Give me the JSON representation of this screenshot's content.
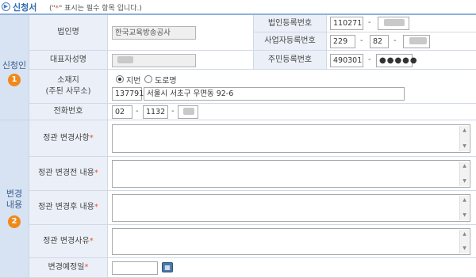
{
  "header": {
    "title": "신청서",
    "note_prefix": "(\"",
    "note_star": "*",
    "note_suffix": "\" 표시는 필수 항목 입니다.)"
  },
  "sections": {
    "applicant": {
      "label": "신청인",
      "badge": "1"
    },
    "change": {
      "label": "변경\n내용",
      "badge": "2"
    }
  },
  "fields": {
    "corp_name": {
      "label": "법인명",
      "value": "한국교육방송공사"
    },
    "corp_reg_no": {
      "label": "법인등록번호",
      "part1": "110271",
      "sep": "-"
    },
    "rep_name": {
      "label": "대표자성명"
    },
    "biz_reg_no": {
      "label": "사업자등록번호",
      "part1": "229",
      "part2": "82",
      "sep": "-"
    },
    "resident_no": {
      "label": "주민등록번호",
      "part1": "490301",
      "sep": "-",
      "masked": "●●●●●"
    },
    "address": {
      "label": "소재지\n(주된 사무소)",
      "radio1": "지번",
      "radio2": "도로명",
      "selected": "지번",
      "zipcode": "137791",
      "addr": "서울시 서초구 우면동 92-6"
    },
    "phone": {
      "label": "전화번호",
      "part1": "02",
      "part2": "1132",
      "sep": "-"
    },
    "before_item": {
      "label": "정관 변경사항",
      "req": "*"
    },
    "before_content": {
      "label": "정관 변경전 내용",
      "req": "*"
    },
    "after_content": {
      "label": "정관 변경후 내용",
      "req": "*"
    },
    "reason": {
      "label": "정관 변경사유",
      "req": "*"
    },
    "due_date": {
      "label": "변경예정일",
      "req": "*",
      "value": ""
    }
  },
  "icons": {
    "header": "circle-arrow-icon",
    "calendar": "calendar-icon",
    "scroll_up": "▲",
    "scroll_down": "▼"
  },
  "colors": {
    "accent": "#2e6bb0",
    "section_bg": "#d7e2f2",
    "label_bg": "#ebf0f8",
    "badge": "#f0891a",
    "required": "#e8542c"
  }
}
